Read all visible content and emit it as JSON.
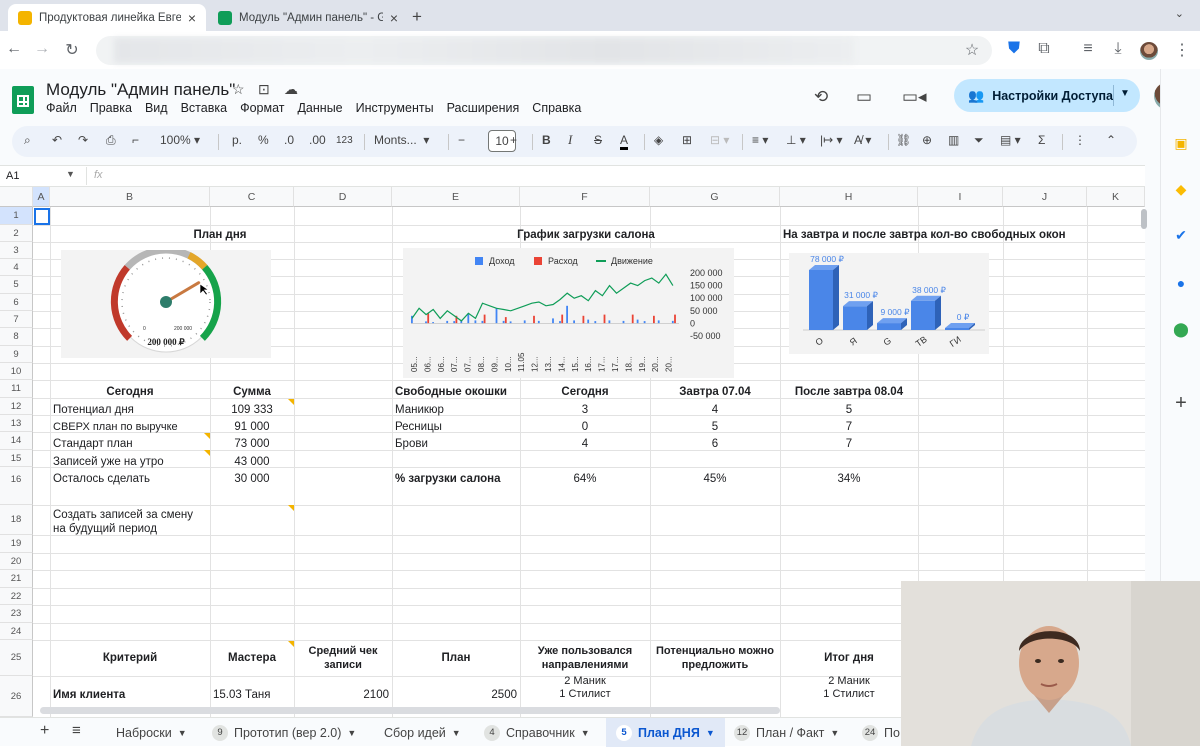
{
  "browser": {
    "tabs": [
      {
        "title": "Продуктовая линейка Евгени",
        "active": true
      },
      {
        "title": "Модуль \"Админ панель\" - G",
        "active": false
      }
    ],
    "new_tab": "+"
  },
  "app": {
    "doc_title": "Модуль \"Админ панель\"",
    "menus": [
      "Файл",
      "Правка",
      "Вид",
      "Вставка",
      "Формат",
      "Данные",
      "Инструменты",
      "Расширения",
      "Справка"
    ],
    "share_label": "Настройки Доступа"
  },
  "toolbar": {
    "zoom": "100%",
    "currency": "р.",
    "percent": "%",
    "dec_less": ".0",
    "dec_more": ".00",
    "num_format": "123",
    "font": "Monts...",
    "font_size": "10",
    "bold": "B",
    "italic": "I",
    "strike": "S",
    "text_color": "A"
  },
  "formula": {
    "cell_ref": "A1",
    "fx": "fx"
  },
  "columns": [
    "A",
    "B",
    "C",
    "D",
    "E",
    "F",
    "G",
    "H",
    "I",
    "J",
    "K"
  ],
  "rows": [
    "1",
    "2",
    "3",
    "4",
    "5",
    "6",
    "7",
    "8",
    "9",
    "10",
    "11",
    "12",
    "13",
    "14",
    "15",
    "16",
    "18",
    "19",
    "20",
    "21",
    "22",
    "23",
    "24",
    "25",
    "26"
  ],
  "sheet": {
    "plan_title": "План дня",
    "gauge_value": "200 000 ₽",
    "gauge_min_label": "0",
    "gauge_mid_label": "200 000",
    "gauge_level": 0.72,
    "chart1_title": "График загрузки салона",
    "chart2_title": "На завтра и после завтра  кол-во свободных окон",
    "summary_header": [
      "Сегодня",
      "Сумма"
    ],
    "summary_rows": [
      {
        "label": "Потенциал дня",
        "value": "109 333"
      },
      {
        "label": "СВЕРХ план по выручке",
        "value": "91 000"
      },
      {
        "label": "Стандарт план",
        "value": "73 000"
      },
      {
        "label": "Записей уже на утро",
        "value": "43 000"
      },
      {
        "label": "Осталось сделать",
        "value": "30 000"
      }
    ],
    "create_note": "Создать записей за смену\nна будущий период",
    "windows_header": [
      "Свободные окошки",
      "Сегодня",
      "Завтра 07.04",
      "После завтра 08.04"
    ],
    "windows_rows": [
      {
        "label": "Маникюр",
        "today": "3",
        "tomorrow": "4",
        "after": "5"
      },
      {
        "label": "Ресницы",
        "today": "0",
        "tomorrow": "5",
        "after": "7"
      },
      {
        "label": "Брови",
        "today": "4",
        "tomorrow": "6",
        "after": "7"
      }
    ],
    "load_row": {
      "label": "% загрузки салона",
      "today": "64%",
      "tomorrow": "45%",
      "after": "34%"
    },
    "criteria_header": [
      "Критерий",
      "Мастера",
      "Средний чек\nзаписи",
      "План",
      "Уже пользовался\nнаправлениями",
      "Потенциально можно\nпредложить",
      "Итог дня"
    ],
    "client_row": {
      "label": "Имя клиента",
      "master": "15.03 Таня",
      "avg": "2100",
      "plan": "2500",
      "used": "2 Маник\n1 Стилист",
      "total": "2 Маник\n1 Стилист"
    }
  },
  "chart_data": [
    {
      "type": "bar+line",
      "legend": [
        "Доход",
        "Расход",
        "Движение"
      ],
      "colors": {
        "income": "#4285f4",
        "expense": "#ea4335",
        "flow": "#0f9d58"
      },
      "y_ticks": [
        "200 000",
        "150 000",
        "100 000",
        "50 000",
        "0",
        "-50 000"
      ],
      "ylim": [
        -50000,
        200000
      ],
      "x_tick_labels": [
        "05...",
        "06...",
        "06...",
        "07...",
        "07...",
        "08...",
        "09...",
        "10...",
        "11.05",
        "12...",
        "13...",
        "14...",
        "15...",
        "16...",
        "17...",
        "17...",
        "18...",
        "19...",
        "20...",
        "20..."
      ],
      "income": [
        30000,
        0,
        0,
        5000,
        0,
        0,
        0,
        0,
        40000,
        0,
        0,
        0,
        60000,
        0,
        0,
        0,
        0,
        0,
        0,
        0,
        20000,
        0,
        70000,
        0,
        0,
        0,
        0,
        0,
        0,
        0,
        0,
        0,
        0,
        0,
        0,
        0,
        0,
        0
      ],
      "expense": [
        0,
        0,
        40000,
        0,
        0,
        0,
        30000,
        0,
        0,
        0,
        35000,
        0,
        0,
        25000,
        0,
        0,
        0,
        30000,
        0,
        0,
        0,
        35000,
        0,
        0,
        30000,
        0,
        0,
        35000,
        0,
        0,
        0,
        35000,
        0,
        0,
        30000,
        0,
        0,
        35000
      ],
      "income_small": [
        12000,
        0,
        8000,
        15000,
        0,
        10000,
        9000,
        14000,
        0,
        12000,
        10000,
        0,
        15000,
        10000,
        8000,
        0,
        12000,
        0,
        10000,
        0,
        14000,
        9000,
        0,
        12000,
        0,
        15000,
        9000,
        0,
        12000,
        0,
        10000,
        0,
        15000,
        9000,
        0,
        12000,
        0,
        10000
      ],
      "flow": [
        20000,
        60000,
        35000,
        55000,
        20000,
        50000,
        30000,
        10000,
        40000,
        20000,
        80000,
        70000,
        60000,
        55000,
        50000,
        60000,
        70000,
        80000,
        85000,
        70000,
        75000,
        95000,
        120000,
        100000,
        110000,
        90000,
        130000,
        110000,
        150000,
        120000,
        140000,
        160000,
        150000,
        170000,
        180000,
        160000,
        195000,
        150000
      ]
    },
    {
      "type": "bar",
      "categories": [
        "О",
        "Я",
        "G",
        "ТВ",
        "ГИ"
      ],
      "values": [
        78000,
        31000,
        9000,
        38000,
        0
      ],
      "data_labels": [
        "78 000 ₽",
        "31 000 ₽",
        "9 000 ₽",
        "38 000 ₽",
        "0 ₽"
      ],
      "color": "#4a86e8"
    }
  ],
  "sheet_tabs": [
    {
      "num": "",
      "label": "Наброски"
    },
    {
      "num": "9",
      "label": "Прототип (вер 2.0)"
    },
    {
      "num": "",
      "label": "Сбор идей"
    },
    {
      "num": "4",
      "label": "Справочник"
    },
    {
      "num": "5",
      "label": "План ДНЯ",
      "active": true
    },
    {
      "num": "12",
      "label": "План / Факт"
    },
    {
      "num": "24",
      "label": "По"
    }
  ]
}
